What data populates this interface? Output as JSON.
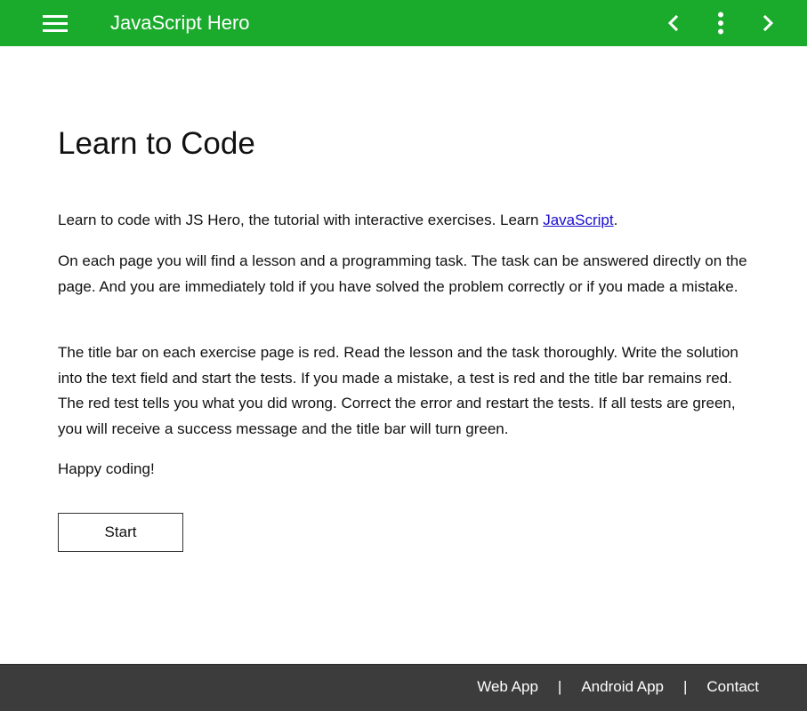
{
  "header": {
    "title": "JavaScript Hero",
    "background_color": "#1aaa2c",
    "menu_icon": "hamburger-menu-icon",
    "prev_icon": "chevron-left-icon",
    "more_icon": "more-vertical-icon",
    "next_icon": "chevron-right-icon"
  },
  "main": {
    "heading": "Learn to Code",
    "p1_text": "Learn to code with JS Hero, the tutorial with interactive exercises. Learn ",
    "p1_link": "JavaScript",
    "p1_end": ".",
    "p2": "On each page you will find a lesson and a programming task. The task can be answered directly on the page. And you are immediately told if you have solved the problem correctly or if you made a mistake.",
    "p3": "The title bar on each exercise page is red. Read the lesson and the task thoroughly. Write the solution into the text field and start the tests. If you made a mistake, a test is red and the title bar remains red. The red test tells you what you did wrong. Correct the error and restart the tests. If all tests are green, you will receive a success message and the title bar will turn green.",
    "p4": "Happy coding!",
    "start_label": "Start",
    "link_color": "#1a0dcc"
  },
  "footer": {
    "background_color": "#3c3c3c",
    "links": [
      "Web App",
      "Android App",
      "Contact"
    ],
    "separator": "|"
  }
}
